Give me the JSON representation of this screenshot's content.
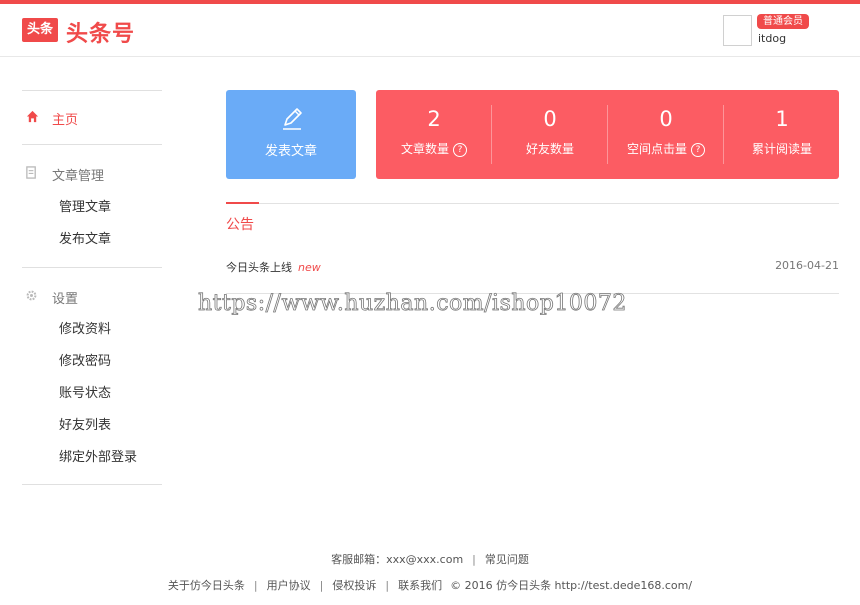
{
  "header": {
    "logo_badge": "头条",
    "logo_text": "头条号",
    "member_badge": "普通会员",
    "username": "itdog"
  },
  "sidebar": {
    "home": {
      "label": "主页",
      "icon": "home-icon"
    },
    "groups": [
      {
        "label": "文章管理",
        "icon": "document-icon",
        "items": [
          "管理文章",
          "发布文章"
        ]
      },
      {
        "label": "设置",
        "icon": "gear-icon",
        "items": [
          "修改资料",
          "修改密码",
          "账号状态",
          "好友列表",
          "绑定外部登录"
        ]
      }
    ]
  },
  "publish": {
    "label": "发表文章",
    "icon": "pen-icon"
  },
  "stats": [
    {
      "value": "2",
      "label": "文章数量",
      "help": "?"
    },
    {
      "value": "0",
      "label": "好友数量"
    },
    {
      "value": "0",
      "label": "空间点击量",
      "help": "?"
    },
    {
      "value": "1",
      "label": "累计阅读量"
    }
  ],
  "notice": {
    "title": "公告",
    "items": [
      {
        "text": "今日头条上线",
        "badge": "new",
        "date": "2016-04-21"
      }
    ]
  },
  "watermark": "https://www.huzhan.com/ishop10072",
  "footer": {
    "line1": [
      "客服邮箱：xxx@xxx.com",
      "常见问题"
    ],
    "line2": [
      "关于仿今日头条",
      "用户协议",
      "侵权投诉",
      "联系我们",
      "© 2016 仿今日头条 http://test.dede168.com/"
    ]
  },
  "colors": {
    "brand_red": "#f04a4a",
    "stats_bg": "#fc5c63",
    "publish_bg": "#6aabf7"
  }
}
